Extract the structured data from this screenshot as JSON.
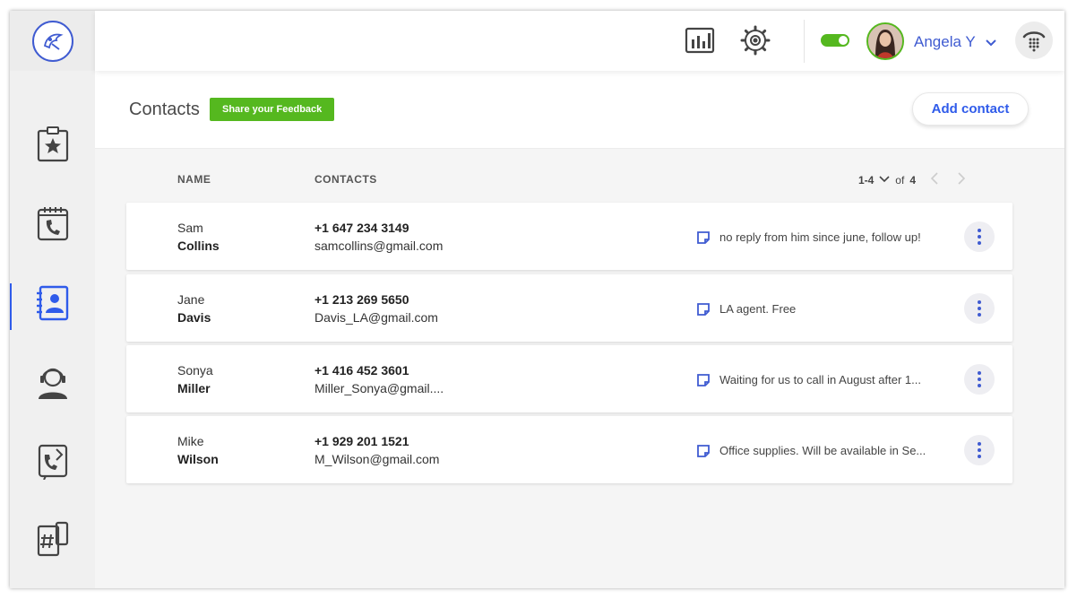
{
  "user": {
    "name": "Angela Y"
  },
  "page": {
    "title": "Contacts",
    "feedback_label": "Share your Feedback",
    "add_label": "Add contact"
  },
  "table": {
    "headers": {
      "name": "NAME",
      "contacts": "CONTACTS"
    },
    "pager": {
      "range": "1-4",
      "of_label": "of",
      "total": "4"
    },
    "rows": [
      {
        "first": "Sam",
        "last": "Collins",
        "phone": "+1 647 234 3149",
        "email": "samcollins@gmail.com",
        "note": "no reply from him since june, follow up!"
      },
      {
        "first": "Jane",
        "last": "Davis",
        "phone": "+1 213 269 5650",
        "email": "Davis_LA@gmail.com",
        "note": "LA agent. Free"
      },
      {
        "first": "Sonya",
        "last": "Miller",
        "phone": "+1 416 452 3601",
        "email": "Miller_Sonya@gmail....",
        "note": "Waiting for us to call in August after 1..."
      },
      {
        "first": "Mike",
        "last": "Wilson",
        "phone": "+1 929 201 1521",
        "email": "M_Wilson@gmail.com",
        "note": "Office supplies. Will be available in Se..."
      }
    ]
  },
  "nav": [
    {
      "icon": "clipboard-star-icon"
    },
    {
      "icon": "calendar-phone-icon"
    },
    {
      "icon": "contacts-book-icon",
      "active": true
    },
    {
      "icon": "agent-headset-icon"
    },
    {
      "icon": "call-transfer-icon"
    },
    {
      "icon": "phone-hash-icon"
    }
  ],
  "colors": {
    "accent": "#2f5bea",
    "green": "#55b81f",
    "text": "#333333"
  }
}
